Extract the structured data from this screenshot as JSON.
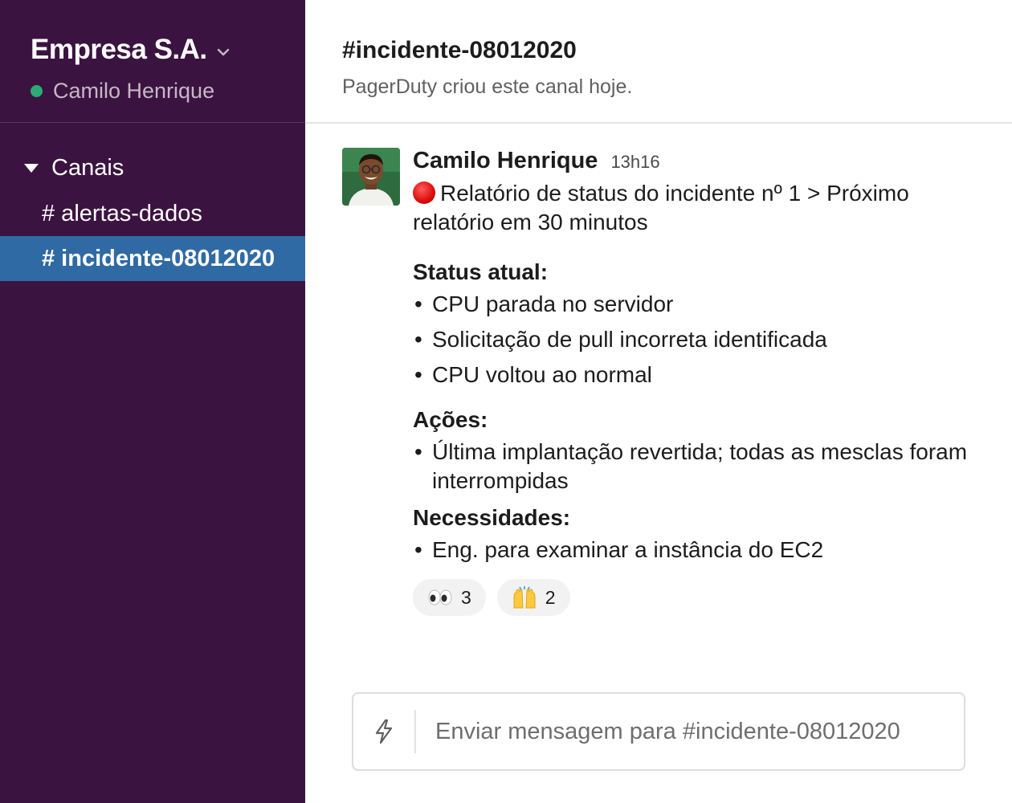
{
  "workspace": {
    "name": "Empresa S.A.",
    "user": "Camilo Henrique",
    "status_color": "#2bac76"
  },
  "sidebar": {
    "section_label": "Canais",
    "channels": [
      {
        "label": "# alertas-dados",
        "active": false
      },
      {
        "label": "# incidente-08012020",
        "active": true
      }
    ]
  },
  "channel": {
    "title": "#incidente-08012020",
    "subtitle": "PagerDuty criou este canal hoje."
  },
  "message": {
    "author": "Camilo Henrique",
    "time": "13h16",
    "intro": "Relatório de status do incidente nº 1 > Próximo relatório em 30 minutos",
    "intro_icon": "red-circle-emoji",
    "status_title": "Status atual:",
    "status_items": [
      "CPU parada no servidor",
      "Solicitação de pull incorreta identificada",
      "CPU voltou ao normal"
    ],
    "actions_title": "Ações:",
    "actions_items": [
      "Última implantação revertida; todas as mesclas foram interrompidas"
    ],
    "needs_title": "Necessidades:",
    "needs_items": [
      "Eng. para examinar a instância do EC2"
    ],
    "reactions": [
      {
        "emoji": "eyes-emoji",
        "count": "3"
      },
      {
        "emoji": "raised-hands-emoji",
        "count": "2"
      }
    ]
  },
  "composer": {
    "placeholder": "Enviar mensagem para #incidente-08012020",
    "icon": "lightning-bolt-icon"
  },
  "colors": {
    "sidebar_bg": "#3b1340",
    "active_channel_bg": "#2f6aa5",
    "text": "#1d1c1d"
  }
}
